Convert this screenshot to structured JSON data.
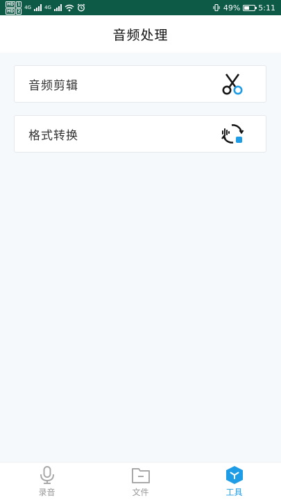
{
  "status_bar": {
    "sim1_tags": [
      "HD",
      "1"
    ],
    "sim2_tags": [
      "HD",
      "2"
    ],
    "network_type_1": "4G",
    "network_type_2": "4G",
    "battery_text": "49%",
    "battery_level_percent": 49,
    "time": "5:11"
  },
  "header": {
    "title": "音频处理"
  },
  "tools": [
    {
      "label": "音频剪辑",
      "icon": "scissors-icon"
    },
    {
      "label": "格式转换",
      "icon": "format-convert-icon"
    }
  ],
  "bottom_nav": {
    "items": [
      {
        "label": "录音",
        "icon": "microphone-icon",
        "active": false
      },
      {
        "label": "文件",
        "icon": "folder-icon",
        "active": false
      },
      {
        "label": "工具",
        "icon": "toolbox-icon",
        "active": true
      }
    ]
  },
  "colors": {
    "status_bar": "#0d5a46",
    "accent": "#1e9de6",
    "inactive": "#9a9a9a",
    "background": "#f6f9fc"
  }
}
